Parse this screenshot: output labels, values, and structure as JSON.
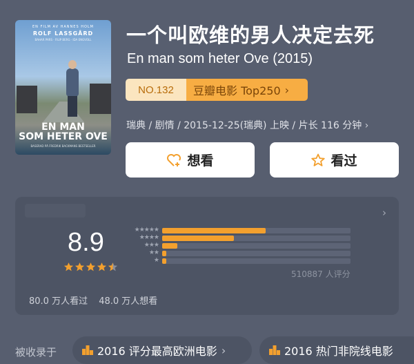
{
  "poster": {
    "tagline": "EN FILM AV HANNES HOLM",
    "actor": "ROLF LASSGÅRD",
    "cast_line": "BAHAR PARS · FILIP BERG · IDA ENGVOLL",
    "title_lines": [
      "EN MAN",
      "SOM HETER OVE"
    ],
    "credit": "BASERAD PÅ FREDRIK BACKMANS BESTSELLER"
  },
  "movie": {
    "title_cn": "一个叫欧维的男人决定去死",
    "title_en": "En man som heter Ove (2015)",
    "rank_no": "NO.132",
    "rank_list": "豆瓣电影 Top250",
    "meta": "瑞典 / 剧情 / 2015-12-25(瑞典) 上映 / 片长 116 分钟"
  },
  "actions": {
    "want_label": "想看",
    "seen_label": "看过"
  },
  "rating": {
    "score": "8.9",
    "stars_value": 4.5,
    "distribution": [
      0.55,
      0.38,
      0.08,
      0.02,
      0.015
    ],
    "count_label": "510887 人评分",
    "seen_count": "80.0 万人看过",
    "want_count": "48.0 万人想看"
  },
  "collections": {
    "label": "被收录于",
    "items": [
      {
        "label": "2016 评分最高欧洲电影"
      },
      {
        "label": "2016 热门非院线电影"
      }
    ]
  },
  "colors": {
    "background": "#575e6f",
    "card": "#4d5464",
    "accent": "#f3a02e",
    "rank_badge_light": "#fbe5bf",
    "rank_badge_dark": "#f7ad43"
  }
}
